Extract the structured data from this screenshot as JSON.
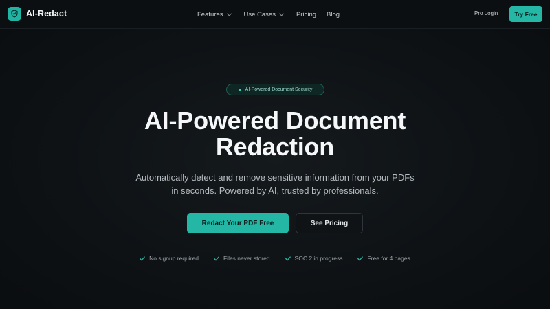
{
  "brand": {
    "name": "AI-Redact",
    "icon": "shield-check-icon",
    "accent_color": "#25b7a6"
  },
  "nav": {
    "links": [
      {
        "label": "Features",
        "has_dropdown": true
      },
      {
        "label": "Use Cases",
        "has_dropdown": true
      },
      {
        "label": "Pricing",
        "has_dropdown": false
      },
      {
        "label": "Blog",
        "has_dropdown": false
      }
    ],
    "pro_login": "Pro Login",
    "try_free": "Try Free"
  },
  "hero": {
    "badge": "AI-Powered Document Security",
    "headline_line1": "AI-Powered Document",
    "headline_line2": "Redaction",
    "subtitle_line1": "Automatically detect and remove sensitive information from your PDFs",
    "subtitle_line2": "in seconds. Powered by AI, trusted by professionals.",
    "primary_cta": "Redact Your PDF Free",
    "secondary_cta": "See Pricing",
    "features": [
      {
        "label": "No signup required",
        "icon": "check-icon"
      },
      {
        "label": "Files never stored",
        "icon": "check-icon"
      },
      {
        "label": "SOC 2 in progress",
        "icon": "check-icon"
      },
      {
        "label": "Free for 4 pages",
        "icon": "check-icon"
      }
    ]
  }
}
